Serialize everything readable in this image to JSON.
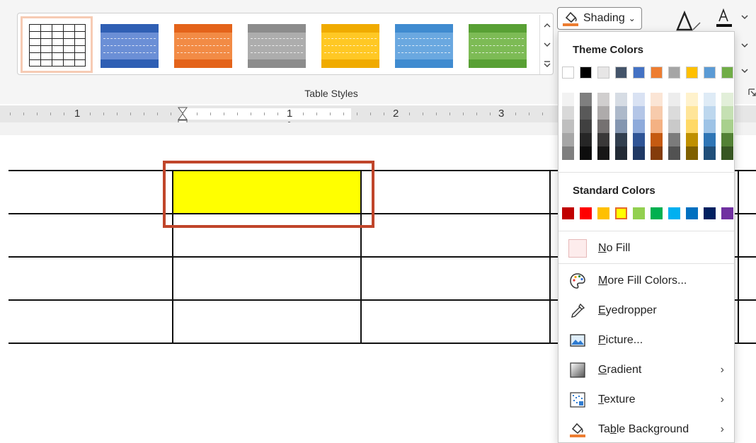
{
  "ribbon": {
    "group_label": "Table Styles",
    "shading_label": "Shading",
    "shading_chevron": "⌄",
    "styles": [
      {
        "name": "plain-grid",
        "selected": true
      },
      {
        "name": "blue",
        "color": "#4472c4"
      },
      {
        "name": "orange",
        "color": "#ed7d31"
      },
      {
        "name": "gray",
        "color": "#a5a5a5"
      },
      {
        "name": "gold",
        "color": "#ffc000"
      },
      {
        "name": "light-blue",
        "color": "#5b9bd5"
      },
      {
        "name": "green",
        "color": "#70ad47"
      }
    ]
  },
  "ruler": {
    "labels": [
      "1",
      "1",
      "2",
      "3"
    ]
  },
  "shading_menu": {
    "theme_header": "Theme Colors",
    "standard_header": "Standard Colors",
    "theme_colors": [
      "#ffffff",
      "#000000",
      "#e7e6e6",
      "#44546a",
      "#4472c4",
      "#ed7d31",
      "#a5a5a5",
      "#ffc000",
      "#5b9bd5",
      "#70ad47"
    ],
    "standard_colors": [
      "#c00000",
      "#ff0000",
      "#ffc000",
      "#ffff00",
      "#92d050",
      "#00b050",
      "#00b0f0",
      "#0070c0",
      "#002060",
      "#7030a0"
    ],
    "selected_standard": "#ffff00",
    "items": {
      "no_fill": {
        "prefix": "",
        "accel": "N",
        "rest": "o Fill"
      },
      "more_fill": {
        "prefix": "",
        "accel": "M",
        "rest": "ore Fill Colors..."
      },
      "eyedropper": {
        "prefix": "",
        "accel": "E",
        "rest": "yedropper"
      },
      "picture": {
        "prefix": "",
        "accel": "P",
        "rest": "icture..."
      },
      "gradient": {
        "prefix": "",
        "accel": "G",
        "rest": "radient"
      },
      "texture": {
        "prefix": "",
        "accel": "T",
        "rest": "exture"
      },
      "table_background": {
        "prefix": "Ta",
        "accel": "b",
        "rest": "le Background"
      }
    },
    "submenu_arrow": "›"
  },
  "document": {
    "highlighted_cell_color": "#ffff00",
    "highlight_border_color": "#c0452a"
  }
}
